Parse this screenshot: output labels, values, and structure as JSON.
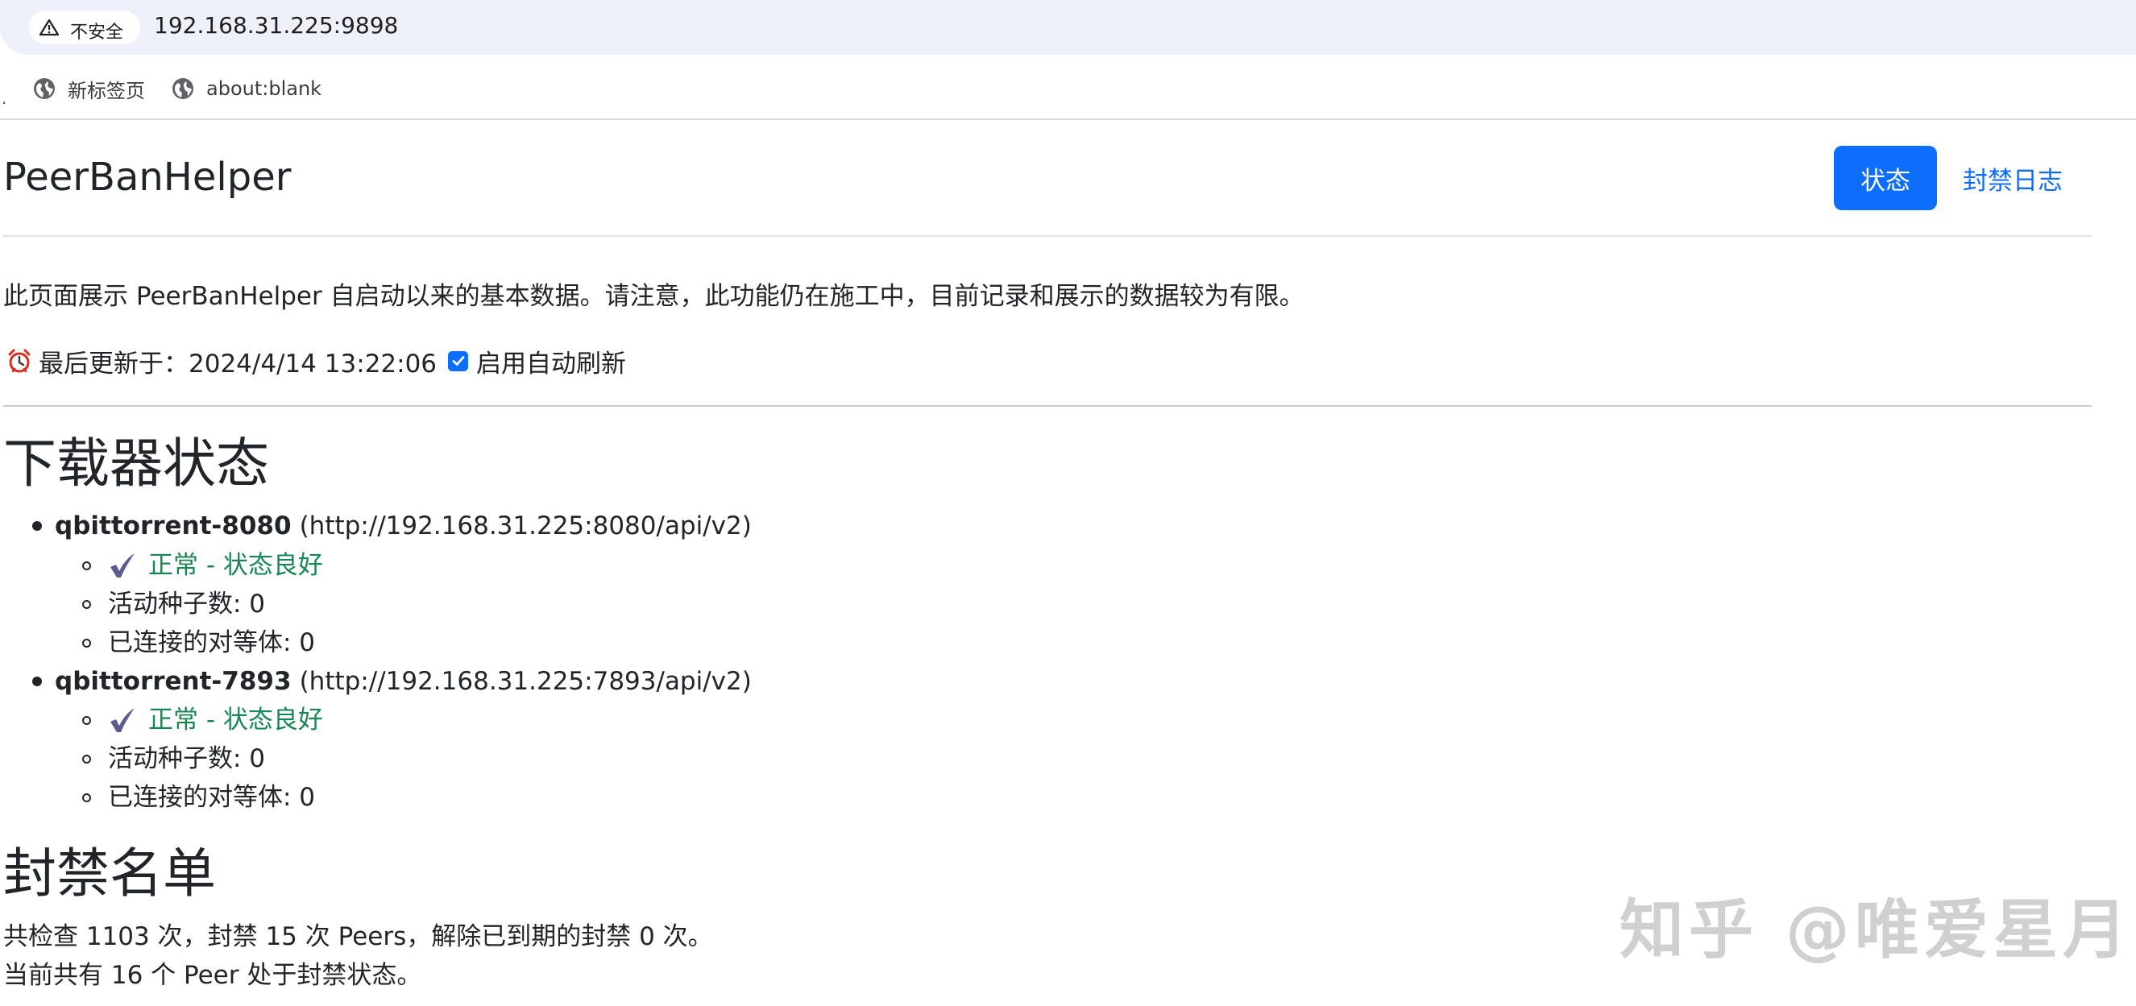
{
  "browser": {
    "security_label": "不安全",
    "url": "192.168.31.225:9898",
    "bookmarks": [
      {
        "label": "新标签页",
        "icon": "globe-icon"
      },
      {
        "label": "about:blank",
        "icon": "globe-icon"
      }
    ]
  },
  "header": {
    "brand": "PeerBanHelper",
    "nav": [
      {
        "label": "状态",
        "active": true
      },
      {
        "label": "封禁日志",
        "active": false
      }
    ]
  },
  "intro": {
    "text": "此页面展示 PeerBanHelper 自启动以来的基本数据。请注意，此功能仍在施工中，目前记录和展示的数据较为有限。"
  },
  "update": {
    "icon": "alarm-clock-icon",
    "label": "最后更新于：2024/4/14 13:22:06",
    "auto_refresh_label": "启用自动刷新",
    "auto_refresh_checked": true
  },
  "downloaders": {
    "heading": "下载器状态",
    "items": [
      {
        "name": "qbittorrent-8080",
        "endpoint": "(http://192.168.31.225:8080/api/v2)",
        "status": "正常 - 状态良好",
        "active_torrents": "活动种子数: 0",
        "connected_peers": "已连接的对等体: 0"
      },
      {
        "name": "qbittorrent-7893",
        "endpoint": "(http://192.168.31.225:7893/api/v2)",
        "status": "正常 - 状态良好",
        "active_torrents": "活动种子数: 0",
        "connected_peers": "已连接的对等体: 0"
      }
    ]
  },
  "banlist": {
    "heading": "封禁名单",
    "summary": "共检查 1103 次，封禁 15 次 Peers，解除已到期的封禁 0 次。",
    "current": "当前共有 16 个 Peer 处于封禁状态。"
  },
  "watermark": "知乎 @唯爱星月",
  "colors": {
    "primary": "#0d6efd",
    "success": "#198754",
    "text": "#212529",
    "address_bar": "#eef1f9"
  }
}
